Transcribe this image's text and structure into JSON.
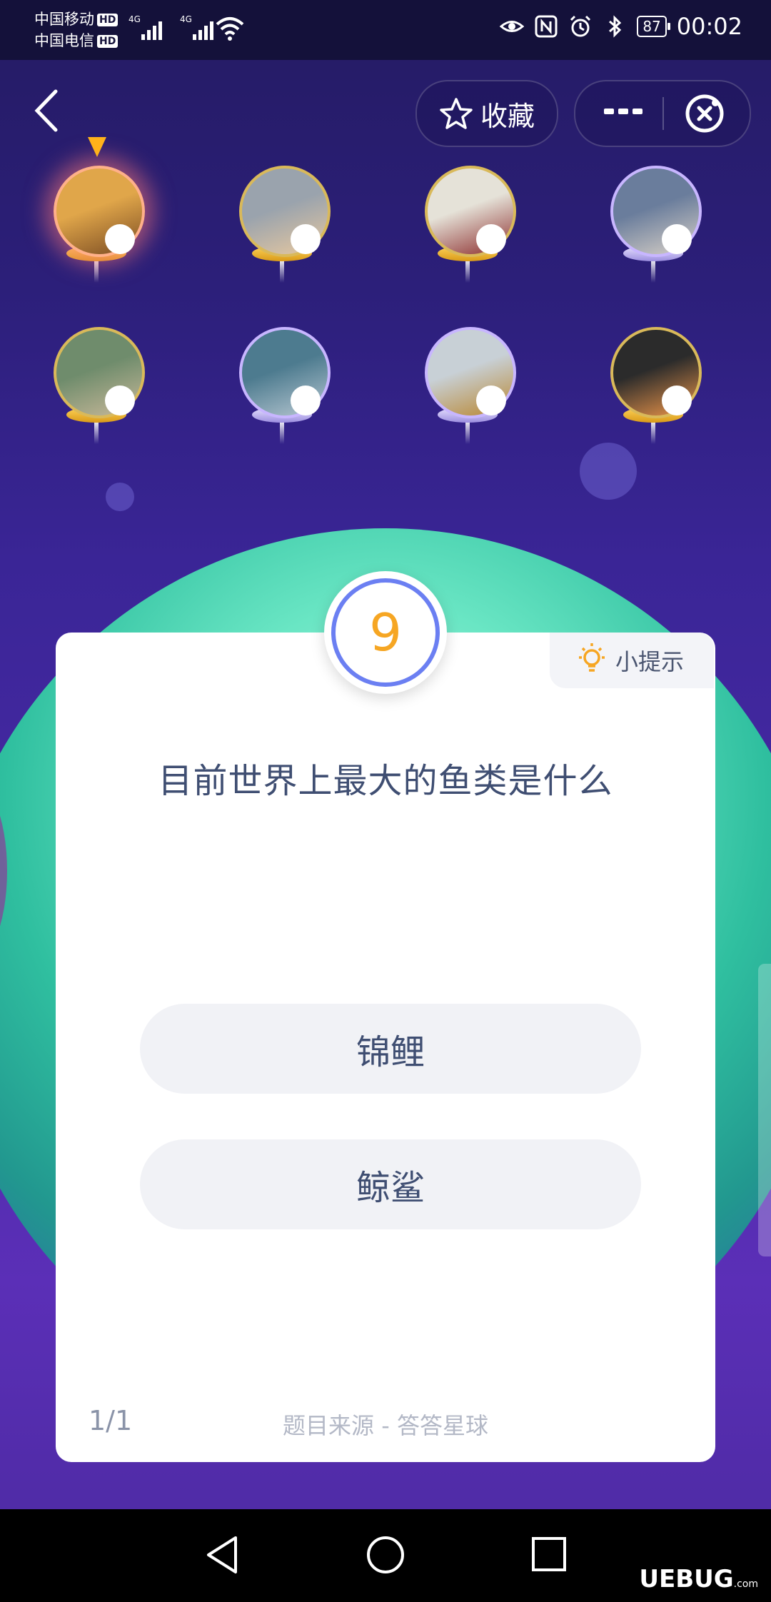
{
  "status_bar": {
    "carrier1": "中国移动",
    "carrier2": "中国电信",
    "hd_badge": "HD",
    "network": "4G",
    "battery": "87",
    "time": "00:02"
  },
  "toolbar": {
    "favorite_label": "收藏"
  },
  "players": [
    {
      "name": "player-1",
      "frame": "gold",
      "active": true,
      "photo_colors": [
        "#e0a64a",
        "#7a4b22"
      ]
    },
    {
      "name": "player-2",
      "frame": "gold",
      "photo_colors": [
        "#9aa3ad",
        "#e8c9a0"
      ]
    },
    {
      "name": "player-3",
      "frame": "gold",
      "photo_colors": [
        "#e5e2d8",
        "#8b2a2a"
      ]
    },
    {
      "name": "player-4",
      "frame": "silver",
      "photo_colors": [
        "#6a7d9c",
        "#d9d1c7"
      ]
    },
    {
      "name": "player-5",
      "frame": "gold",
      "photo_colors": [
        "#6f8c6c",
        "#c9b99a"
      ]
    },
    {
      "name": "player-6",
      "frame": "silver",
      "photo_colors": [
        "#4d7b8f",
        "#b7c7d1"
      ]
    },
    {
      "name": "player-7",
      "frame": "silver",
      "photo_colors": [
        "#c8d0d6",
        "#b9862e"
      ]
    },
    {
      "name": "player-8",
      "frame": "gold",
      "photo_colors": [
        "#2b2b2b",
        "#f0974a"
      ]
    }
  ],
  "quiz": {
    "question_number": "9",
    "hint_label": "小提示",
    "question": "目前世界上最大的鱼类是什么",
    "options": [
      "锦鲤",
      "鲸鲨"
    ],
    "counter": "1/1",
    "source": "题目来源 - 答答星球"
  },
  "watermark": {
    "text": "UEBUG",
    "suffix": ".com"
  },
  "colors": {
    "accent_ring": "#6b7ff2",
    "number": "#f6a623",
    "text_primary": "#3f4e72"
  }
}
